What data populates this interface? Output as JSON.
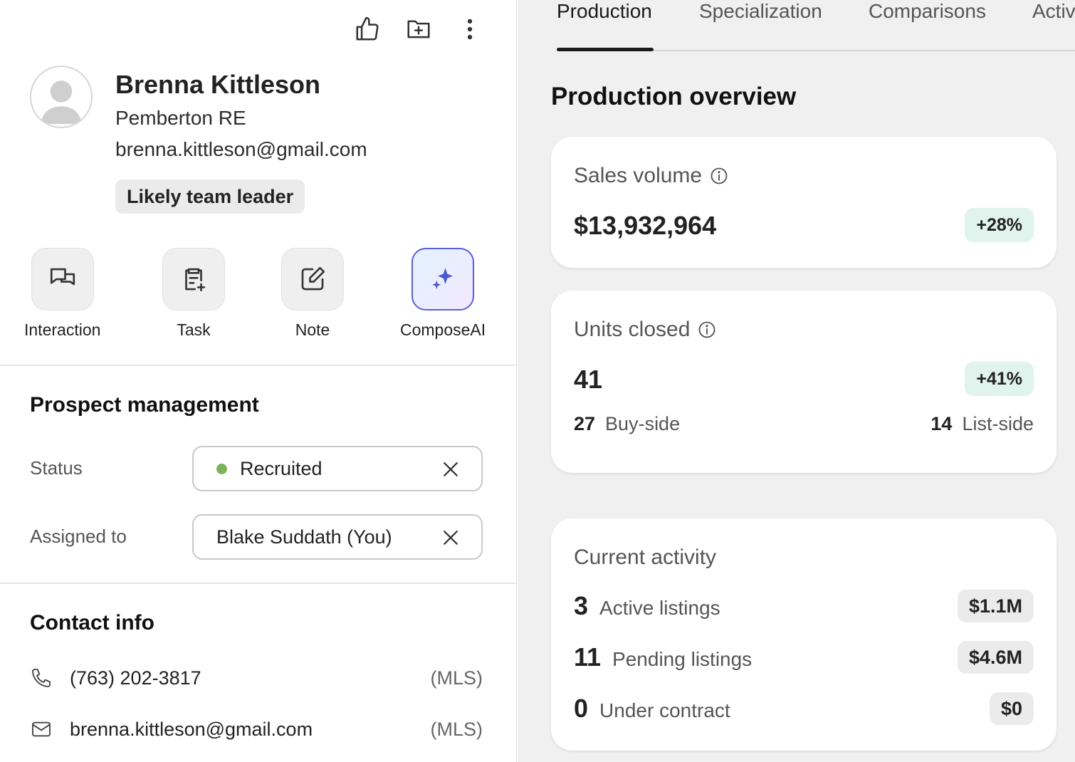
{
  "profile": {
    "name": "Brenna Kittleson",
    "company": "Pemberton RE",
    "email": "brenna.kittleson@gmail.com",
    "tag": "Likely team leader"
  },
  "toolbar": {
    "icons": [
      "thumbs-up-icon",
      "folder-add-icon",
      "more-vertical-icon"
    ]
  },
  "actions": [
    {
      "label": "Interaction",
      "icon": "chat-bubbles-icon"
    },
    {
      "label": "Task",
      "icon": "clipboard-add-icon"
    },
    {
      "label": "Note",
      "icon": "edit-note-icon"
    },
    {
      "label": "ComposeAI",
      "icon": "sparkle-icon"
    }
  ],
  "prospect": {
    "title": "Prospect management",
    "status_label": "Status",
    "status_value": "Recruited",
    "status_color": "#7cb35a",
    "assigned_label": "Assigned to",
    "assigned_value": "Blake Suddath (You)"
  },
  "contact": {
    "title": "Contact info",
    "phone": "(763) 202-3817",
    "phone_source": "(MLS)",
    "email": "brenna.kittleson@gmail.com",
    "email_source": "(MLS)"
  },
  "tabs": [
    "Production",
    "Specialization",
    "Comparisons",
    "Activ"
  ],
  "active_tab": "Production",
  "overview": {
    "title": "Production overview",
    "sales": {
      "title": "Sales volume",
      "value": "$13,932,964",
      "change": "+28%"
    },
    "units": {
      "title": "Units closed",
      "value": "41",
      "change": "+41%",
      "buy_num": "27",
      "buy_label": "Buy-side",
      "list_num": "14",
      "list_label": "List-side"
    },
    "current": {
      "title": "Current activity",
      "rows": [
        {
          "num": "3",
          "label": "Active listings",
          "value": "$1.1M"
        },
        {
          "num": "11",
          "label": "Pending listings",
          "value": "$4.6M"
        },
        {
          "num": "0",
          "label": "Under contract",
          "value": "$0"
        }
      ]
    }
  },
  "colors": {
    "accent_ai": "#5a5fd6",
    "positive_pill": "#e0f3ec",
    "panel_bg": "#f0f0f0"
  }
}
